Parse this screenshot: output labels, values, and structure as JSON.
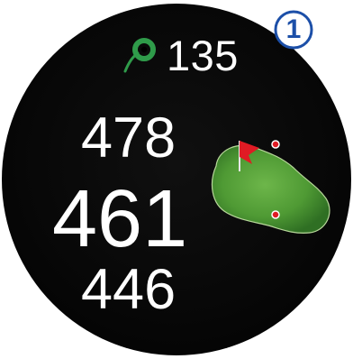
{
  "header": {
    "hole_number": "1",
    "hole_label_value": "135",
    "icon": "golf-pin-icon"
  },
  "distances": {
    "back": "478",
    "middle": "461",
    "front": "446"
  },
  "colors": {
    "background": "#000000",
    "text": "#ffffff",
    "green": "#5aa23a",
    "flag": "#e01b24",
    "icon_green": "#2f9b4a",
    "badge_blue": "#1c4fa8"
  }
}
